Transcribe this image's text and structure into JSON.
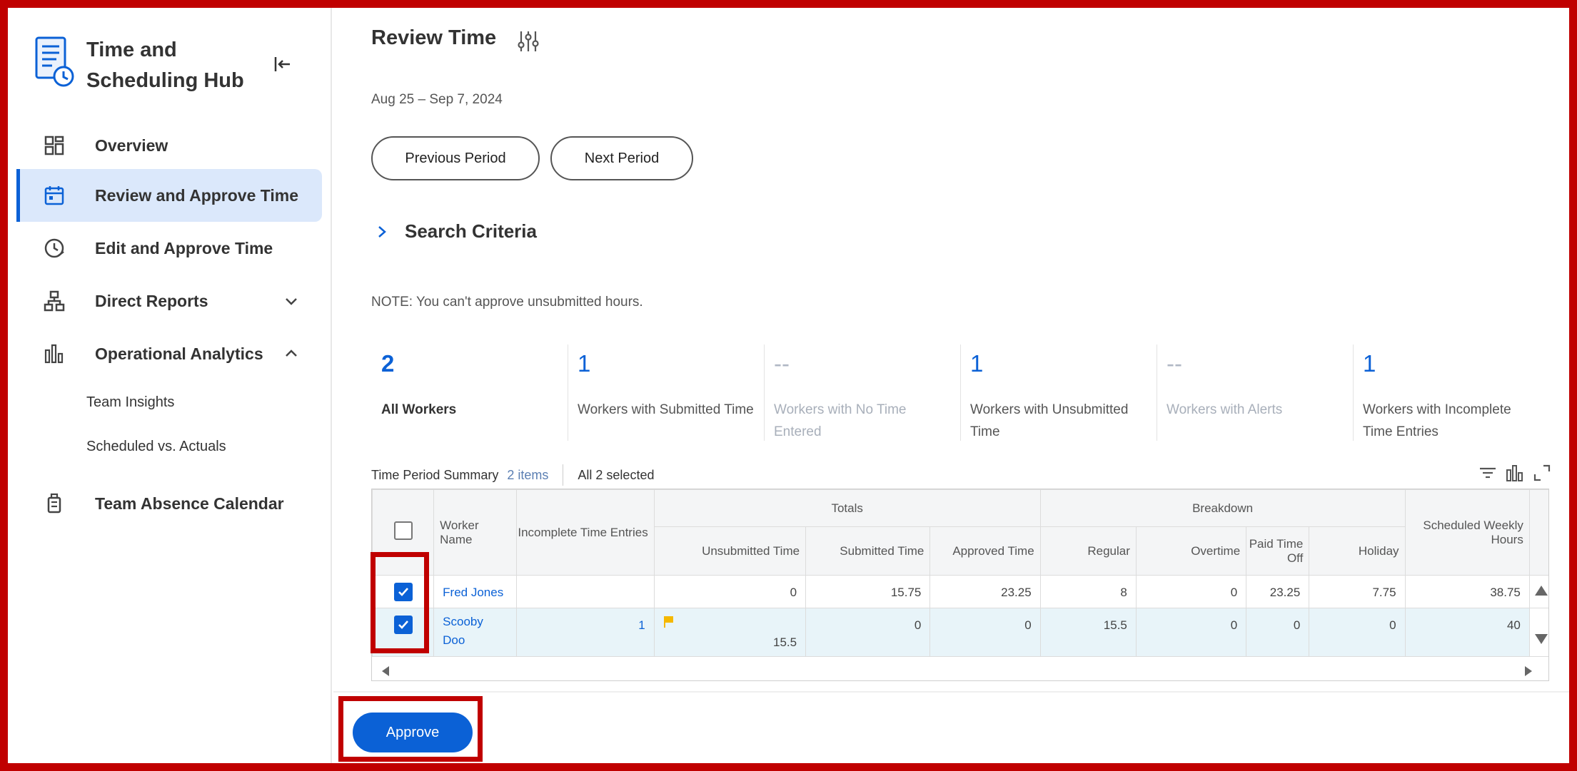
{
  "sidebar": {
    "hub_title_line1": "Time and",
    "hub_title_line2": "Scheduling Hub",
    "items": [
      {
        "label": "Overview"
      },
      {
        "label": "Review and Approve Time"
      },
      {
        "label": "Edit and Approve Time"
      },
      {
        "label": "Direct Reports"
      },
      {
        "label": "Operational Analytics"
      },
      {
        "label": "Team Absence Calendar"
      }
    ],
    "sub_items": [
      {
        "label": "Team Insights"
      },
      {
        "label": "Scheduled vs. Actuals"
      }
    ]
  },
  "main": {
    "title": "Review Time",
    "date_range": "Aug 25 – Sep 7, 2024",
    "previous_label": "Previous Period",
    "next_label": "Next Period",
    "search_criteria": "Search Criteria",
    "note": "NOTE: You can't approve unsubmitted hours.",
    "cards": [
      {
        "num": "2",
        "label": "All Workers"
      },
      {
        "num": "1",
        "label": "Workers with Submitted Time"
      },
      {
        "num": "--",
        "label": "Workers with No Time Entered"
      },
      {
        "num": "1",
        "label": "Workers with Unsubmitted Time"
      },
      {
        "num": "--",
        "label": "Workers with Alerts"
      },
      {
        "num": "1",
        "label": "Workers with Incomplete Time Entries"
      }
    ],
    "table_title": "Time Period Summary",
    "table_count": "2 items",
    "selected_text": "All 2 selected",
    "groups": {
      "totals": "Totals",
      "breakdown": "Breakdown"
    },
    "columns": {
      "worker_name": "Worker Name",
      "incomplete": "Incomplete Time Entries",
      "unsubmitted": "Unsubmitted Time",
      "submitted": "Submitted Time",
      "approved": "Approved Time",
      "regular": "Regular",
      "overtime": "Overtime",
      "pto": "Paid Time Off",
      "holiday": "Holiday",
      "scheduled": "Scheduled Weekly Hours"
    },
    "rows": [
      {
        "name": "Fred Jones",
        "incomplete": "",
        "unsubmitted": "0",
        "submitted": "15.75",
        "approved": "23.25",
        "regular": "8",
        "overtime": "0",
        "pto": "23.25",
        "holiday": "7.75",
        "scheduled": "38.75"
      },
      {
        "name_line1": "Scooby",
        "name_line2": "Doo",
        "incomplete": "1",
        "unsubmitted": "15.5",
        "submitted": "0",
        "approved": "0",
        "regular": "15.5",
        "overtime": "0",
        "pto": "0",
        "holiday": "0",
        "scheduled": "40"
      }
    ],
    "approve_label": "Approve"
  },
  "colors": {
    "accent": "#0b61d6",
    "highlight_frame": "#c00000",
    "selected_row": "#e8f4f9",
    "flag": "#f5b800"
  }
}
